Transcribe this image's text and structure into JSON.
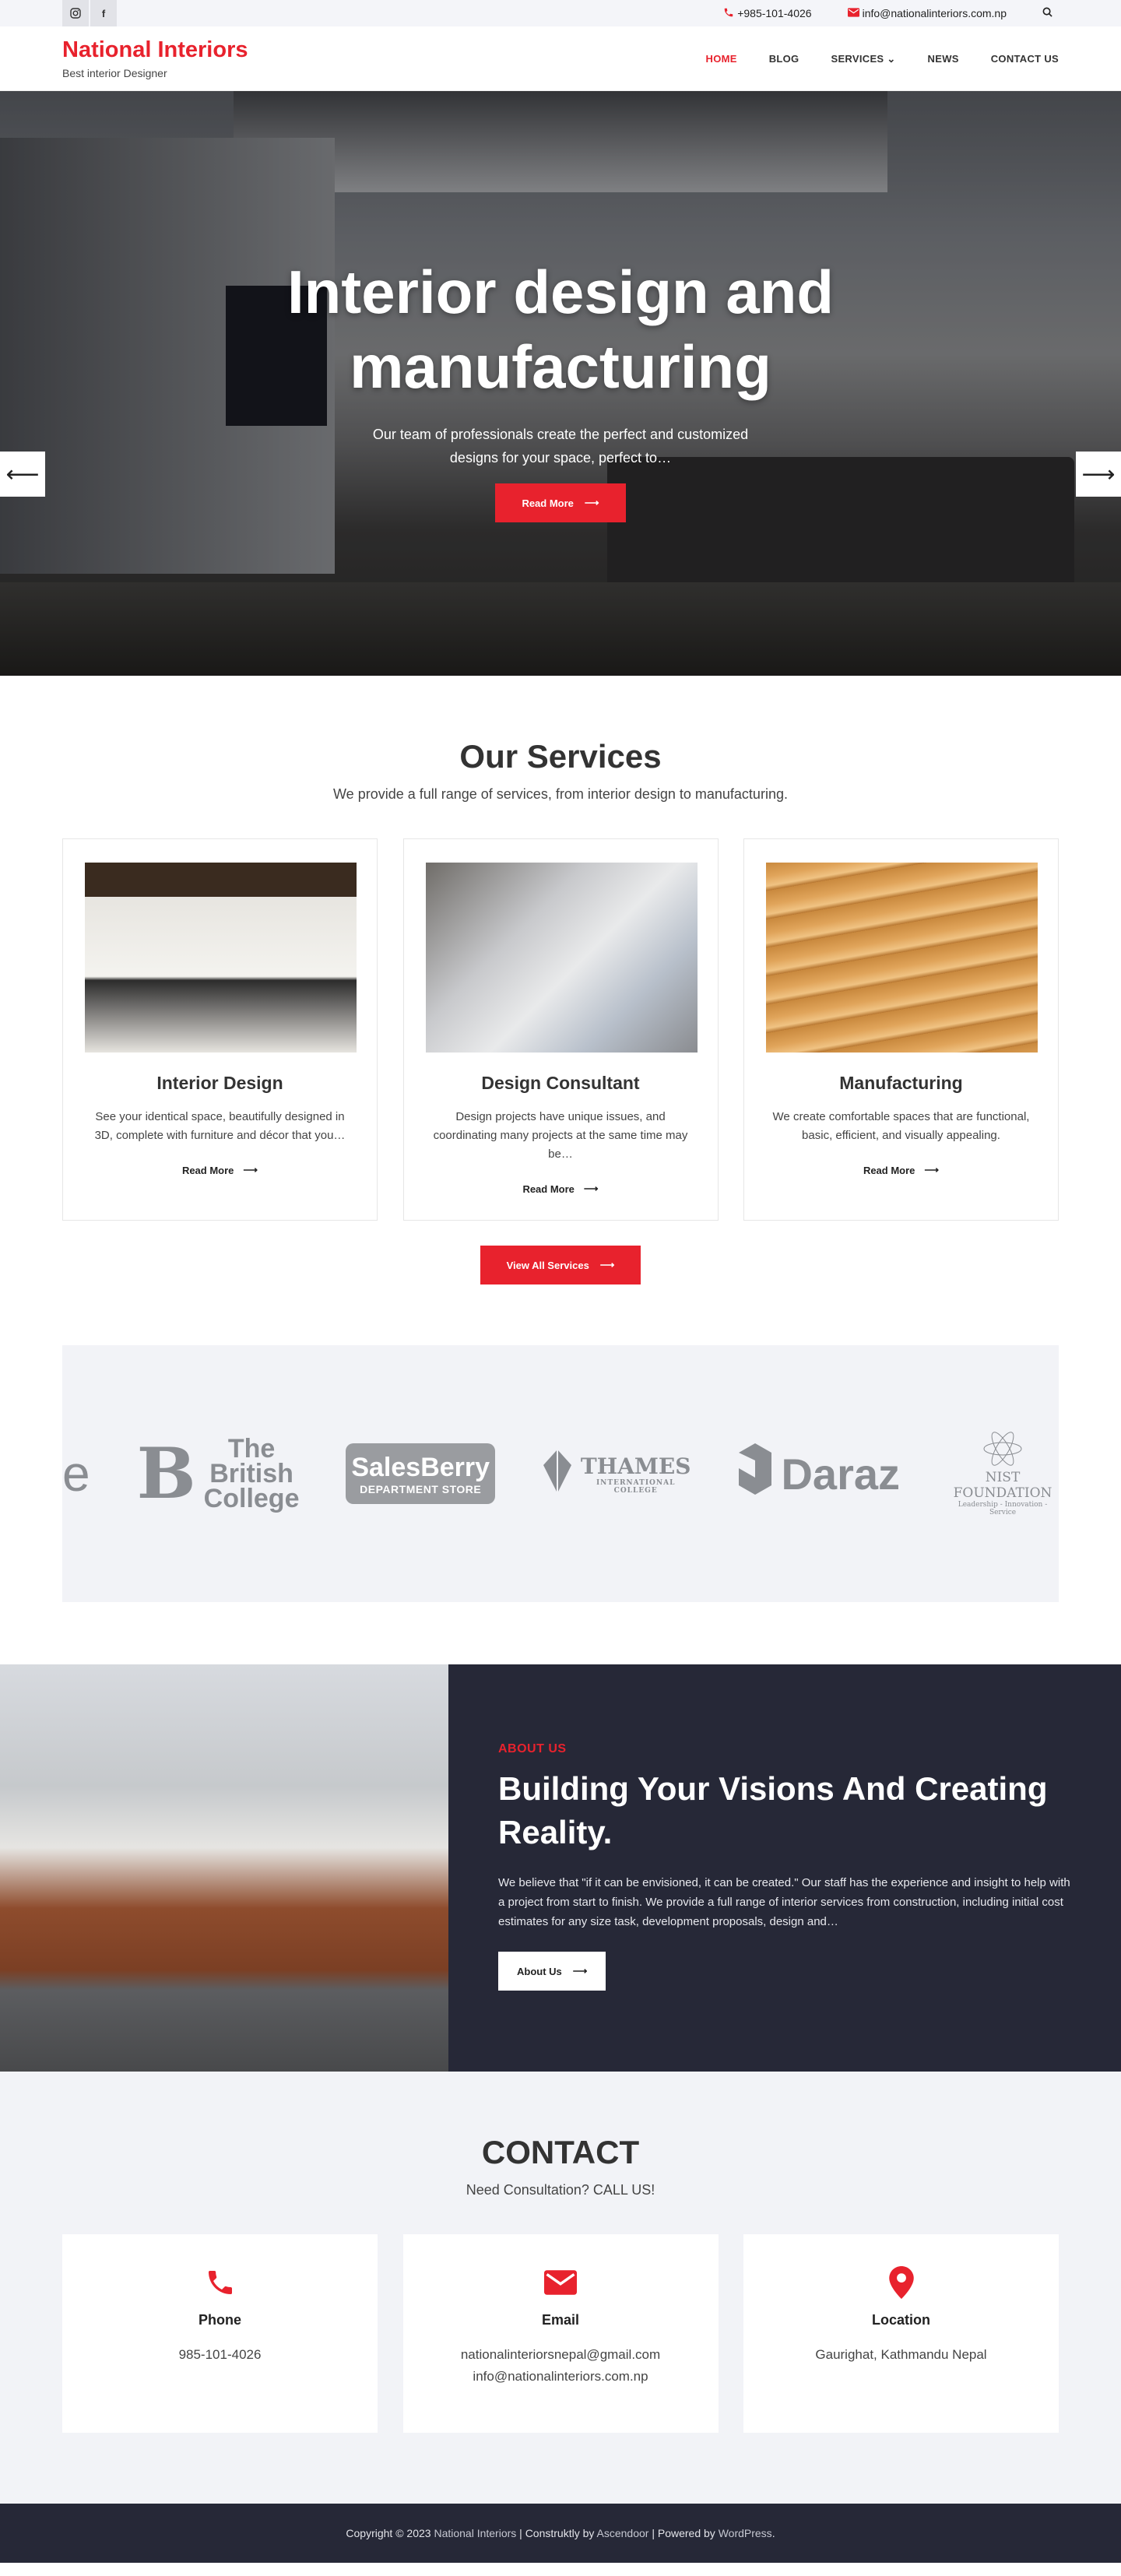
{
  "topbar": {
    "social": [
      {
        "icon": "instagram-icon",
        "glyph": "◎"
      },
      {
        "icon": "facebook-icon",
        "glyph": "f"
      }
    ],
    "phone": "+985-101-4026",
    "email": "info@nationalinteriors.com.np"
  },
  "header": {
    "brand": "National Interiors",
    "tagline": "Best interior Designer",
    "nav": [
      "HOME",
      "BLOG",
      "SERVICES",
      "NEWS",
      "CONTACT US"
    ]
  },
  "hero": {
    "title_line1": "Interior design and",
    "title_line2": "manufacturing",
    "text": "Our team of professionals create the perfect and customized designs for your space, perfect to…",
    "button": "Read More"
  },
  "services": {
    "title": "Our Services",
    "subtitle": "We provide a full range of services, from interior design to manufacturing.",
    "cards": [
      {
        "title": "Interior Design",
        "text": "See your identical space, beautifully designed in 3D, complete with furniture and décor that you…",
        "link": "Read More"
      },
      {
        "title": "Design Consultant",
        "text": "Design projects have unique issues, and coordinating many projects at the same time may be…",
        "link": "Read More"
      },
      {
        "title": "Manufacturing",
        "text": "We create comfortable spaces that are functional, basic, efficient, and visually appealing.",
        "link": "Read More"
      }
    ],
    "all_button": "View All Services"
  },
  "logos": {
    "fragment": "e",
    "british": [
      "The",
      "British",
      "College"
    ],
    "salesberry": [
      "SalesBerry",
      "DEPARTMENT STORE"
    ],
    "thames": [
      "THAMES",
      "INTERNATIONAL COLLEGE"
    ],
    "daraz": "Daraz",
    "nist": [
      "NIST FOUNDATION",
      "Leadership - Innovation - Service"
    ]
  },
  "about": {
    "eyebrow": "ABOUT US",
    "title": "Building Your Visions And Creating Reality.",
    "text": "We believe that \"if it can be envisioned, it can be created.\" Our staff has the experience and insight to help with a project from start to finish. We provide a full range of interior services from construction, including initial cost estimates for any size task, development proposals, design and…",
    "button": "About Us"
  },
  "contact": {
    "title": "CONTACT",
    "subtitle": "Need Consultation? CALL US!",
    "cards": [
      {
        "icon": "phone-icon",
        "title": "Phone",
        "lines": [
          "985-101-4026"
        ]
      },
      {
        "icon": "envelope-icon",
        "title": "Email",
        "lines": [
          "nationalinteriorsnepal@gmail.com",
          "info@nationalinteriors.com.np"
        ]
      },
      {
        "icon": "map-pin-icon",
        "title": "Location",
        "lines": [
          "Gaurighat, Kathmandu Nepal"
        ]
      }
    ]
  },
  "footer": {
    "prefix": "Copyright © 2023 ",
    "brand": "National Interiors",
    "mid": " | Construktly by ",
    "author": "Ascendoor",
    "mid2": " | Powered by ",
    "platform": "WordPress",
    "end": "."
  },
  "colors": {
    "accent": "#e8222d",
    "dark": "#262837",
    "light_bg": "#f2f3f7"
  }
}
